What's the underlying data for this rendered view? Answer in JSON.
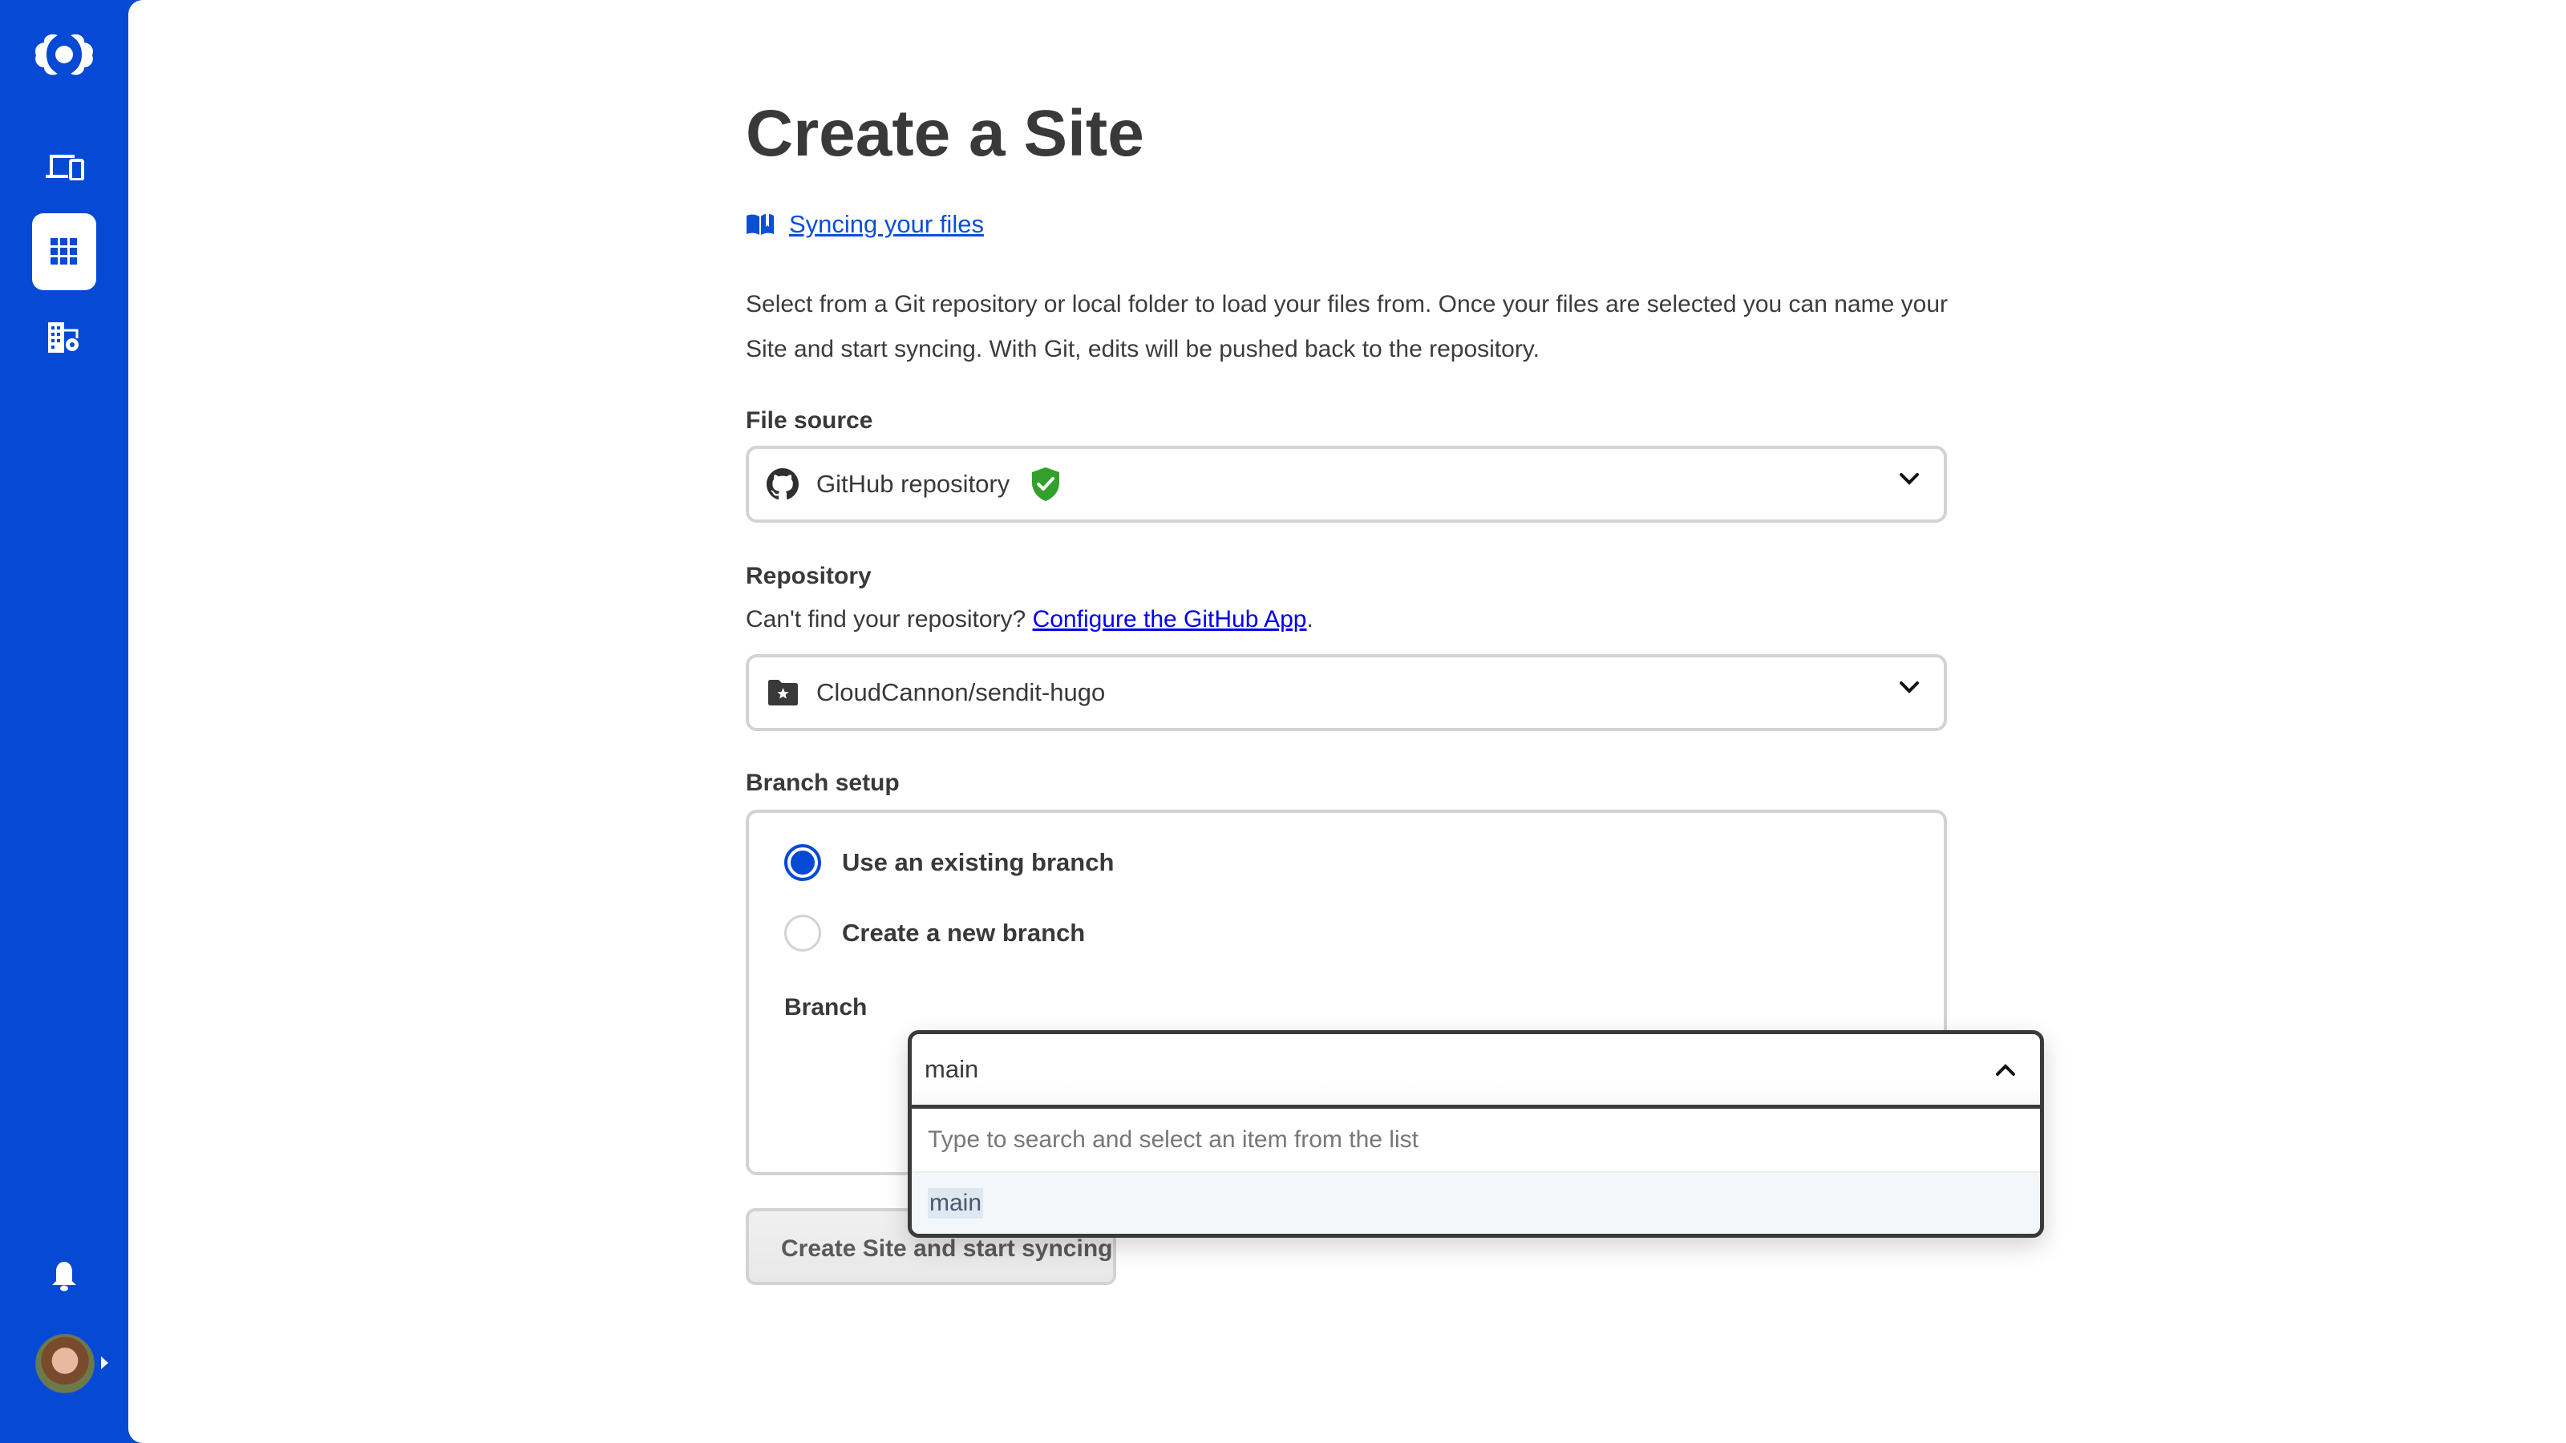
{
  "sidebar": {
    "logo": "cloudcannon-logo",
    "items": [
      {
        "name": "devices-icon",
        "active": false
      },
      {
        "name": "apps-grid-icon",
        "active": true
      },
      {
        "name": "organization-settings-icon",
        "active": false
      }
    ],
    "notifications_icon": "bell-icon",
    "user_avatar": "user-avatar"
  },
  "colors": {
    "brand": "#0649d4",
    "link": "#0a4fd6",
    "verified": "#33a02c"
  },
  "page": {
    "title": "Create a Site",
    "doc_link": "Syncing your files",
    "description": "Select from a Git repository or local folder to load your files from. Once your files are selected you can name your Site and start syncing. With Git, edits will be pushed back to the repository."
  },
  "file_source": {
    "label": "File source",
    "value": "GitHub repository",
    "verified_icon": "shield-check-icon"
  },
  "repository": {
    "label": "Repository",
    "helper_prefix": "Can't find your repository? ",
    "helper_link": "Configure the GitHub App",
    "helper_suffix": ".",
    "value": "CloudCannon/sendit-hugo"
  },
  "branch_setup": {
    "label": "Branch setup",
    "options": [
      {
        "label": "Use an existing branch",
        "checked": true
      },
      {
        "label": "Create a new branch",
        "checked": false
      }
    ],
    "branch_label": "Branch",
    "branch_value": "main",
    "dropdown_hint": "Type to search and select an item from the list",
    "dropdown_options": [
      "main"
    ]
  },
  "submit_button": "Create Site and start syncing"
}
